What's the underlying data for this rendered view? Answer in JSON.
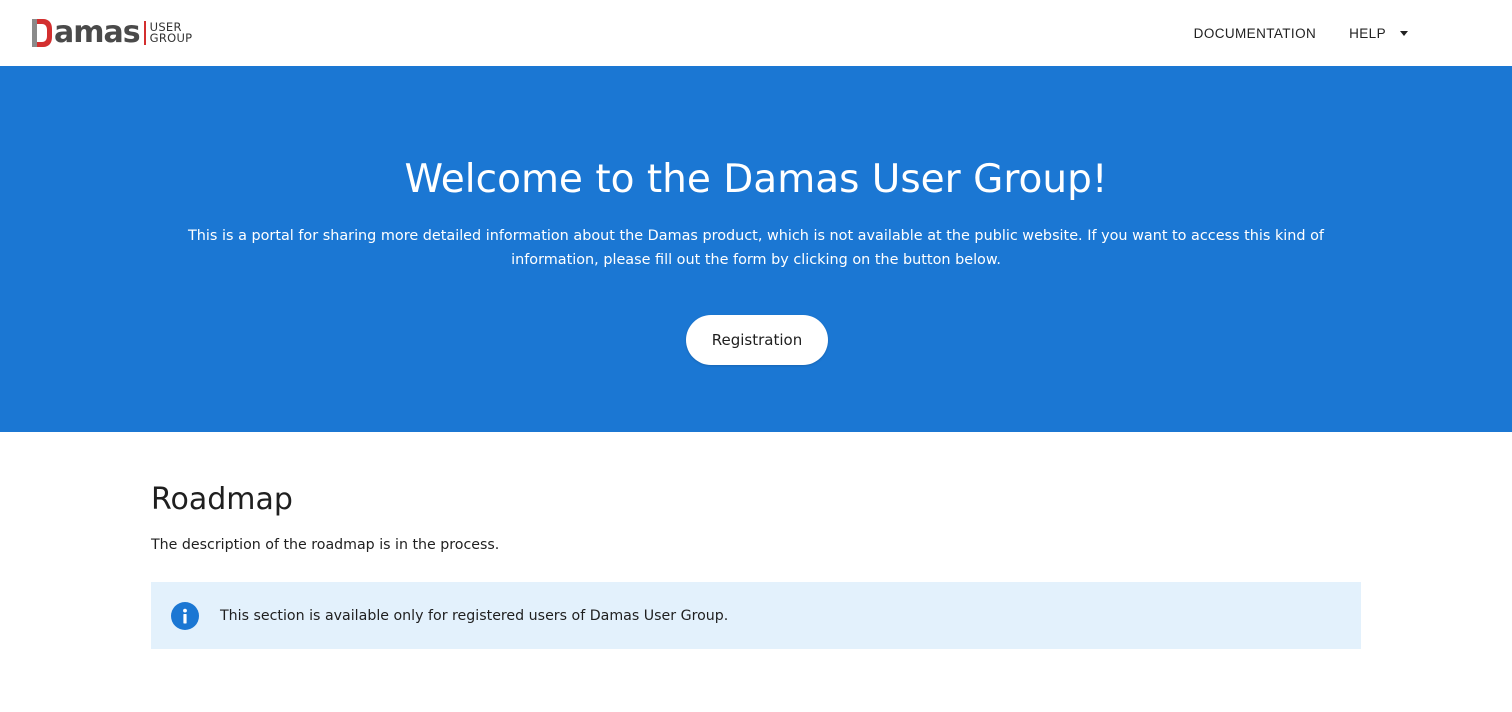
{
  "header": {
    "logo": {
      "word": "Damas",
      "sub_line1": "USER",
      "sub_line2": "GROUP",
      "accent_color": "#d32f2f"
    },
    "nav": [
      {
        "label": "DOCUMENTATION",
        "icon": null
      },
      {
        "label": "HELP",
        "icon": "caret-down-icon"
      }
    ]
  },
  "hero": {
    "background_color": "#1b77d3",
    "title": "Welcome to the Damas User Group!",
    "text": "This is a portal for sharing more detailed information about the Damas product, which is not available at the public website. If you want to access this kind of information, please fill out the form by clicking on the button below.",
    "button_label": "Registration"
  },
  "roadmap": {
    "title": "Roadmap",
    "description": "The description of the roadmap is in the process.",
    "alert": {
      "icon": "info-icon",
      "background_color": "#e3f1fc",
      "text": "This section is available only for registered users of Damas User Group."
    }
  }
}
